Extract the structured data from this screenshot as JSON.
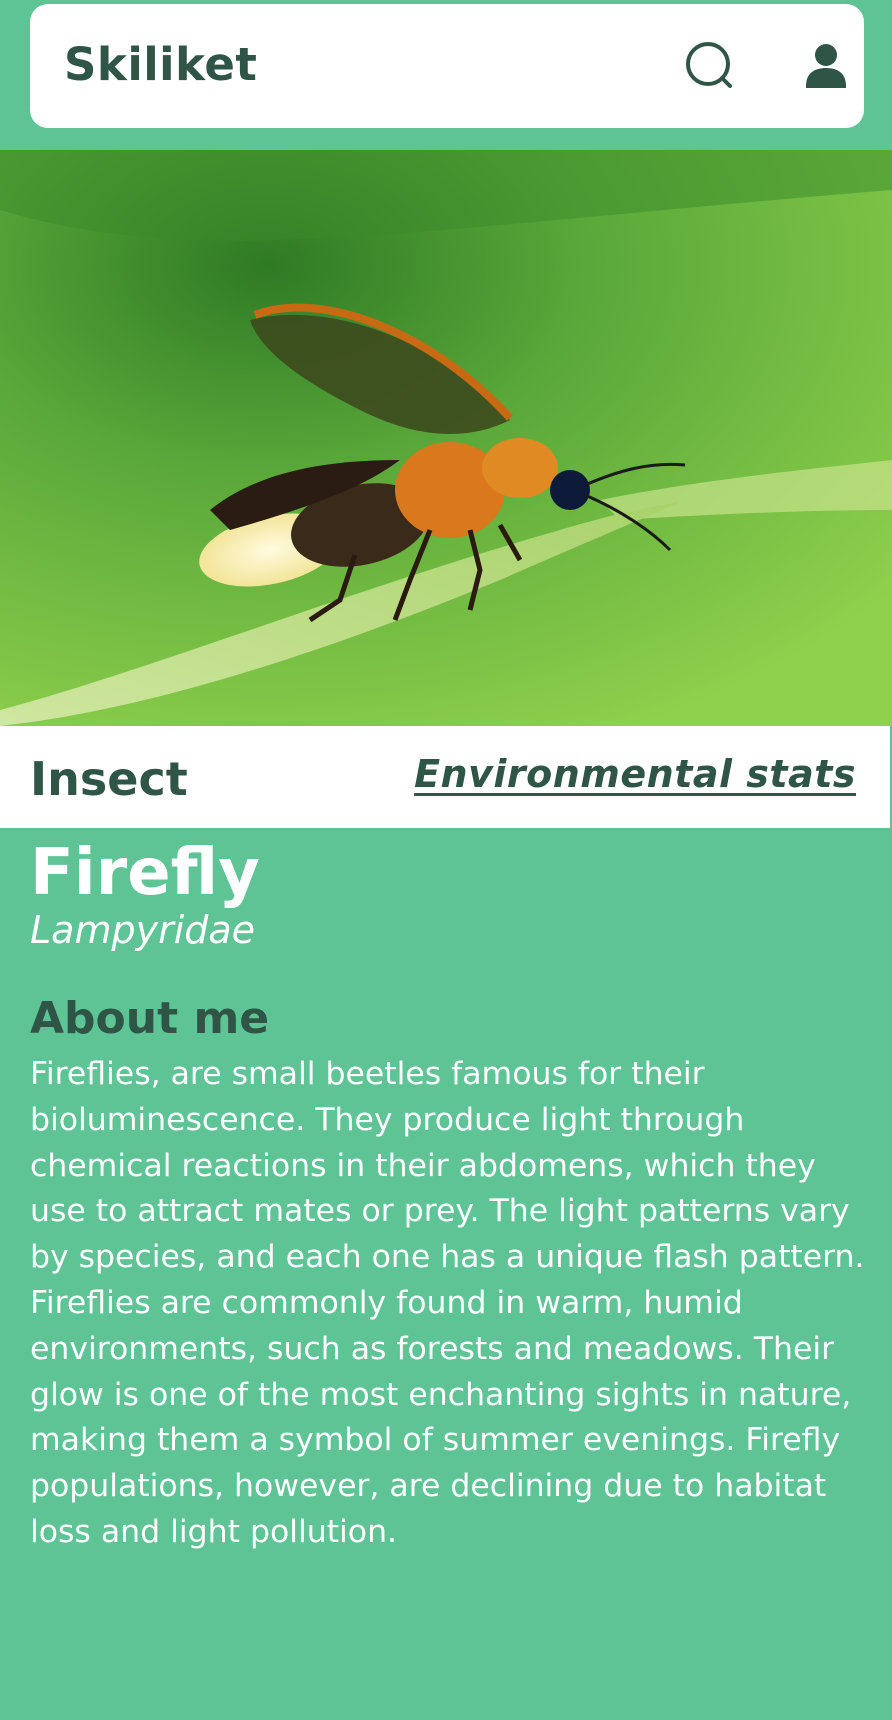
{
  "app": {
    "title": "Skiliket"
  },
  "header": {
    "search_icon": "search-icon",
    "user_icon": "user-icon"
  },
  "hero": {
    "icon": "firefly-photo"
  },
  "tag_bar": {
    "category": "Insect",
    "env_link": "Environmental  stats"
  },
  "species": {
    "name": "Firefly",
    "scientific_name": "Lampyridae"
  },
  "about": {
    "heading": "About me",
    "text": "Fireflies, are small beetles famous for their bioluminescence. They produce light through chemical reactions in their abdomens, which they use to attract mates or prey. The light patterns vary by species, and each one has a unique flash pattern. Fireflies are commonly found in warm, humid environments, such as forests and meadows. Their glow is one of the most enchanting sights in nature, making them a symbol of summer evenings. Firefly populations, however, are declining due to habitat loss and light pollution."
  },
  "colors": {
    "background": "#5ec496",
    "dark_text": "#2f5546",
    "white": "#ffffff"
  }
}
